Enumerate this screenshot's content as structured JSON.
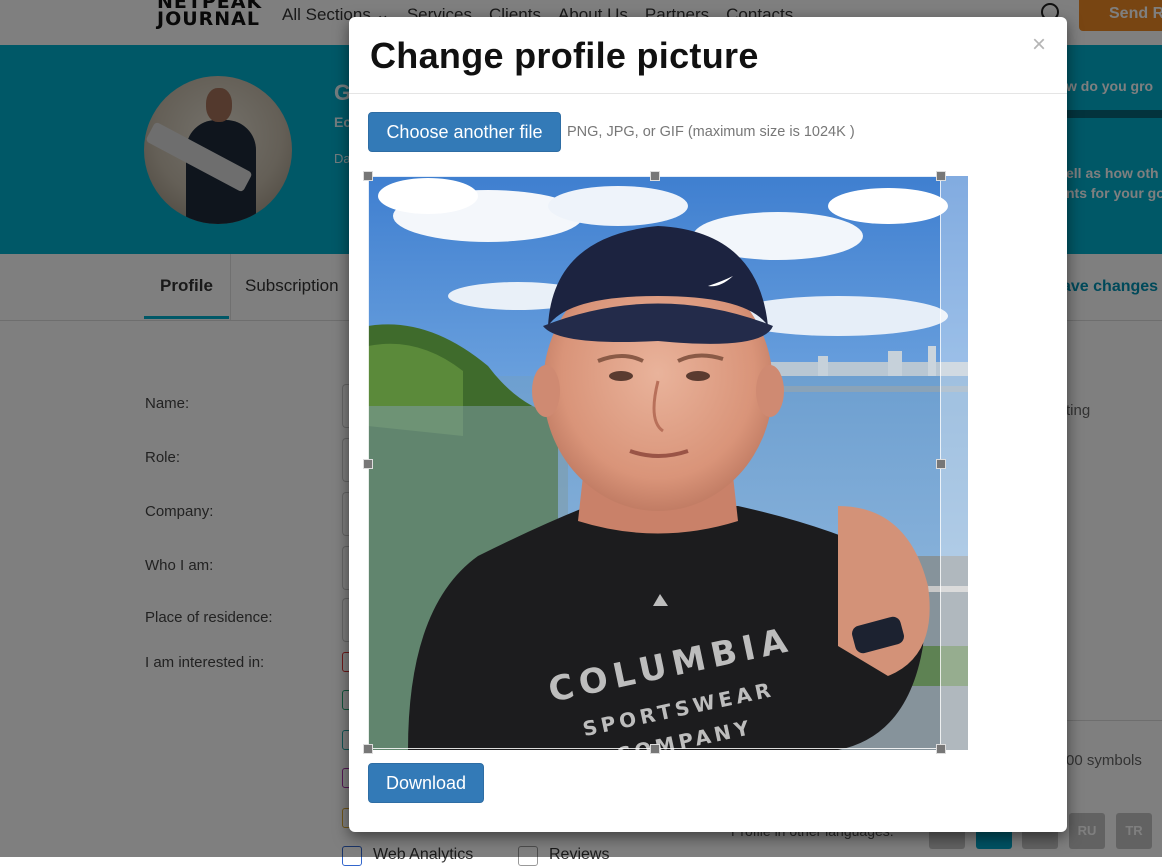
{
  "nav": {
    "logo_line1": "NETPEAK",
    "logo_line2": "JOURNAL",
    "links": [
      "All Sections",
      "Services",
      "Clients",
      "About Us",
      "Partners",
      "Contacts"
    ],
    "cta": "Send R"
  },
  "hero": {
    "name_partial": "G",
    "role_partial": "Ec",
    "date_partial": "Da",
    "right_line1": "w do you gro",
    "right_line2a": "ell as how oth",
    "right_line2b": "nts for your go"
  },
  "tabs": {
    "profile": "Profile",
    "subscriptions": "Subscription",
    "save": "ave changes"
  },
  "form": {
    "labels": [
      "Name:",
      "Role:",
      "Company:",
      "Who I am:",
      "Place of residence:",
      "I am interested in:"
    ],
    "right_field": "ting",
    "symbols_note": "00 symbols",
    "other_langs_label": "Profile in other languages:",
    "langs": [
      "RU",
      "TR"
    ],
    "checkbox_web_analytics": "Web Analytics",
    "checkbox_reviews": "Reviews"
  },
  "modal": {
    "title": "Change profile picture",
    "close": "×",
    "choose_button": "Choose another file",
    "hint": "PNG, JPG, or GIF (maximum size is 1024K )",
    "download_button": "Download"
  },
  "photo": {
    "shirt_line1": "COLUMBIA",
    "shirt_line2": "SPORTSWEAR",
    "shirt_line3": "COMPANY"
  },
  "colors": {
    "accent": "#00b0cf",
    "primary_button": "#337ab7",
    "cta": "#f08a24"
  }
}
